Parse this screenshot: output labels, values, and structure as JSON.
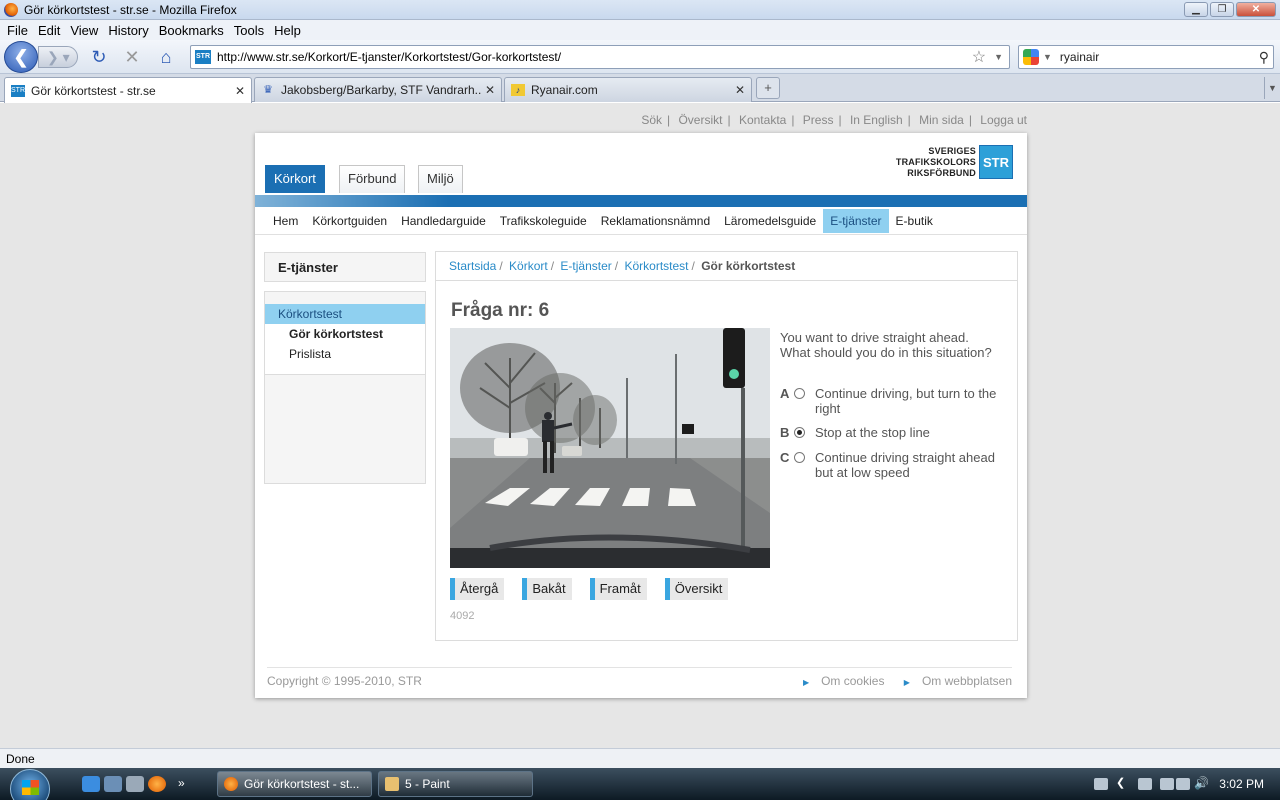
{
  "window": {
    "title": "Gör körkortstest - str.se - Mozilla Firefox"
  },
  "menu": [
    "File",
    "Edit",
    "View",
    "History",
    "Bookmarks",
    "Tools",
    "Help"
  ],
  "address": {
    "url": "http://www.str.se/Korkort/E-tjanster/Korkortstest/Gor-korkortstest/",
    "search_value": "ryainair"
  },
  "tabs": [
    {
      "label": "Gör körkortstest - str.se",
      "icon": "str-favicon"
    },
    {
      "label": "Jakobsberg/Barkarby, STF Vandrarh...",
      "icon": "crown-favicon"
    },
    {
      "label": "Ryanair.com",
      "icon": "harp-favicon"
    }
  ],
  "site": {
    "toplinks": [
      "Sök",
      "Översikt",
      "Kontakta",
      "Press",
      "In English",
      "Min sida",
      "Logga ut"
    ],
    "maintabs": [
      "Körkort",
      "Förbund",
      "Miljö"
    ],
    "logo": {
      "line1": "SVERIGES",
      "line2": "TRAFIKSKOLORS",
      "line3": "RIKSFÖRBUND",
      "mark": "STR"
    },
    "subnav": [
      "Hem",
      "Körkortguiden",
      "Handledarguide",
      "Trafikskoleguide",
      "Reklamationsnämnd",
      "Läromedelsguide",
      "E-tjänster",
      "E-butik"
    ],
    "sidebar": {
      "heading": "E-tjänster",
      "items": [
        {
          "label": "Körkortstest"
        },
        {
          "label": "Gör körkortstest"
        },
        {
          "label": "Prislista"
        }
      ]
    },
    "breadcrumb": [
      "Startsida",
      "Körkort",
      "E-tjänster",
      "Körkortstest",
      "Gör körkortstest"
    ],
    "question": {
      "title": "Fråga nr: 6",
      "text": "You want to drive straight ahead. What should you do in this situation?",
      "answers": [
        {
          "letter": "A",
          "text": "Continue driving, but turn to the right",
          "selected": false
        },
        {
          "letter": "B",
          "text": "Stop at the stop line",
          "selected": true
        },
        {
          "letter": "C",
          "text": "Continue driving straight ahead but at low speed",
          "selected": false
        }
      ],
      "buttons": [
        "Återgå",
        "Bakåt",
        "Framåt",
        "Översikt"
      ],
      "id": "4092"
    },
    "footer": {
      "copyright": "Copyright © 1995-2010, STR",
      "links": [
        "Om cookies",
        "Om webbplatsen"
      ]
    }
  },
  "status": "Done",
  "taskbar": {
    "items": [
      "Gör körkortstest - st...",
      "5 - Paint"
    ],
    "clock": "3:02 PM"
  },
  "colors": {
    "accent": "#1b6fb3",
    "highlight": "#8fd0f0",
    "link": "#2a8bc8"
  }
}
